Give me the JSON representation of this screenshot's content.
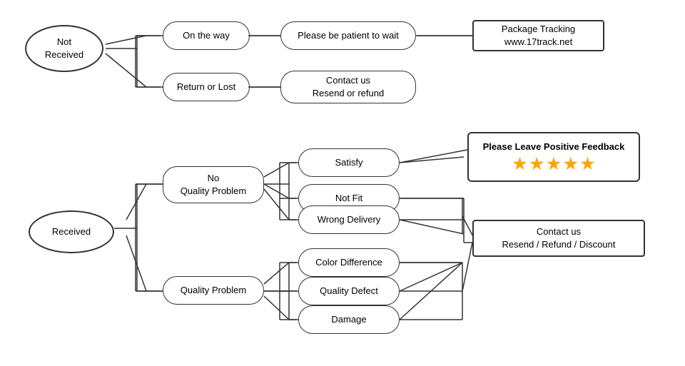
{
  "nodes": {
    "not_received": {
      "label": "Not\nReceived"
    },
    "on_the_way": {
      "label": "On the way"
    },
    "return_or_lost": {
      "label": "Return or Lost"
    },
    "please_be_patient": {
      "label": "Please be patient to wait"
    },
    "contact_us_resend": {
      "label": "Contact us\nResend or refund"
    },
    "package_tracking": {
      "label": "Package Tracking\nwww.17track.net"
    },
    "received": {
      "label": "Received"
    },
    "no_quality_problem": {
      "label": "No\nQuality Problem"
    },
    "quality_problem": {
      "label": "Quality Problem"
    },
    "satisfy": {
      "label": "Satisfy"
    },
    "not_fit": {
      "label": "Not Fit"
    },
    "wrong_delivery": {
      "label": "Wrong Delivery"
    },
    "color_difference": {
      "label": "Color Difference"
    },
    "quality_defect": {
      "label": "Quality Defect"
    },
    "damage": {
      "label": "Damage"
    },
    "feedback": {
      "label": "Please Leave Positive Feedback"
    },
    "contact_us_refund": {
      "label": "Contact us\nResend / Refund / Discount"
    }
  },
  "stars": [
    "★",
    "★",
    "★",
    "★",
    "★"
  ],
  "colors": {
    "border": "#333",
    "star": "#FFA500"
  }
}
